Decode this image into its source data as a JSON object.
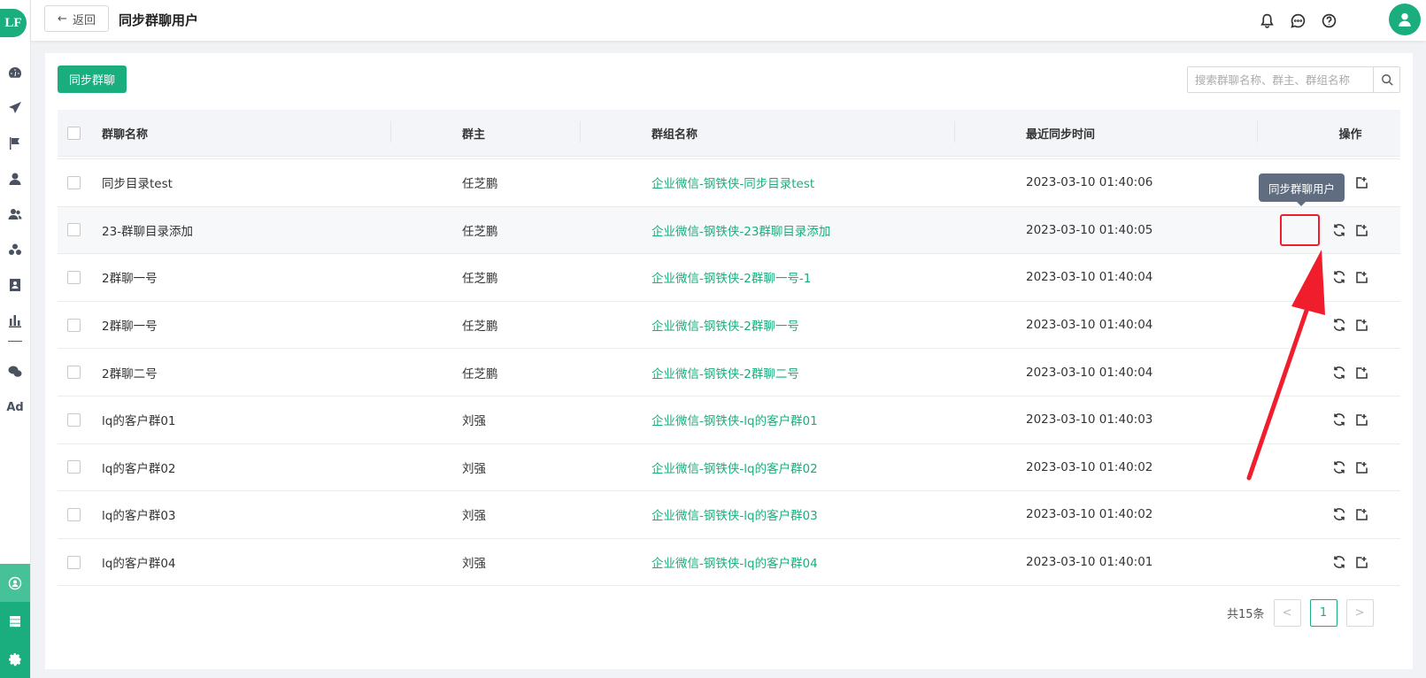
{
  "app": {
    "logo_text": "LF"
  },
  "sidebar": {
    "items": [
      {
        "icon": "dashboard-icon"
      },
      {
        "icon": "send-icon"
      },
      {
        "icon": "flag-icon"
      },
      {
        "icon": "user-icon"
      },
      {
        "icon": "users-icon"
      },
      {
        "icon": "group-icon"
      },
      {
        "icon": "contact-card-icon"
      },
      {
        "icon": "bar-chart-icon"
      },
      {
        "icon": "wechat-icon"
      }
    ],
    "ad_label": "Ad",
    "bottom_items": [
      {
        "icon": "customer-group-icon",
        "active": true
      },
      {
        "icon": "server-icon"
      },
      {
        "icon": "settings-icon"
      }
    ]
  },
  "header": {
    "back_label": "返回",
    "title": "同步群聊用户"
  },
  "toolbar": {
    "sync_button_label": "同步群聊",
    "search_placeholder": "搜索群聊名称、群主、群组名称"
  },
  "table": {
    "columns": {
      "name": "群聊名称",
      "owner": "群主",
      "group": "群组名称",
      "time": "最近同步时间",
      "ops": "操作"
    },
    "rows": [
      {
        "name": "同步目录test",
        "owner": "任芝鹏",
        "group": "企业微信-钢铁侠-同步目录test",
        "time": "2023-03-10 01:40:06"
      },
      {
        "name": "23-群聊目录添加",
        "owner": "任芝鹏",
        "group": "企业微信-钢铁侠-23群聊目录添加",
        "time": "2023-03-10 01:40:05"
      },
      {
        "name": "2群聊一号",
        "owner": "任芝鹏",
        "group": "企业微信-钢铁侠-2群聊一号-1",
        "time": "2023-03-10 01:40:04"
      },
      {
        "name": "2群聊一号",
        "owner": "任芝鹏",
        "group": "企业微信-钢铁侠-2群聊一号",
        "time": "2023-03-10 01:40:04"
      },
      {
        "name": "2群聊二号",
        "owner": "任芝鹏",
        "group": "企业微信-钢铁侠-2群聊二号",
        "time": "2023-03-10 01:40:04"
      },
      {
        "name": "lq的客户群01",
        "owner": "刘强",
        "group": "企业微信-钢铁侠-lq的客户群01",
        "time": "2023-03-10 01:40:03"
      },
      {
        "name": "lq的客户群02",
        "owner": "刘强",
        "group": "企业微信-钢铁侠-lq的客户群02",
        "time": "2023-03-10 01:40:02"
      },
      {
        "name": "lq的客户群03",
        "owner": "刘强",
        "group": "企业微信-钢铁侠-lq的客户群03",
        "time": "2023-03-10 01:40:02"
      },
      {
        "name": "lq的客户群04",
        "owner": "刘强",
        "group": "企业微信-钢铁侠-lq的客户群04",
        "time": "2023-03-10 01:40:01"
      }
    ]
  },
  "tooltip": {
    "text": "同步群聊用户"
  },
  "pagination": {
    "total_label": "共15条",
    "current_page": "1",
    "prev": "<",
    "next": ">"
  },
  "colors": {
    "accent": "#1aad7e",
    "annotation": "#f01e2c",
    "tooltip_bg": "#606d80"
  }
}
